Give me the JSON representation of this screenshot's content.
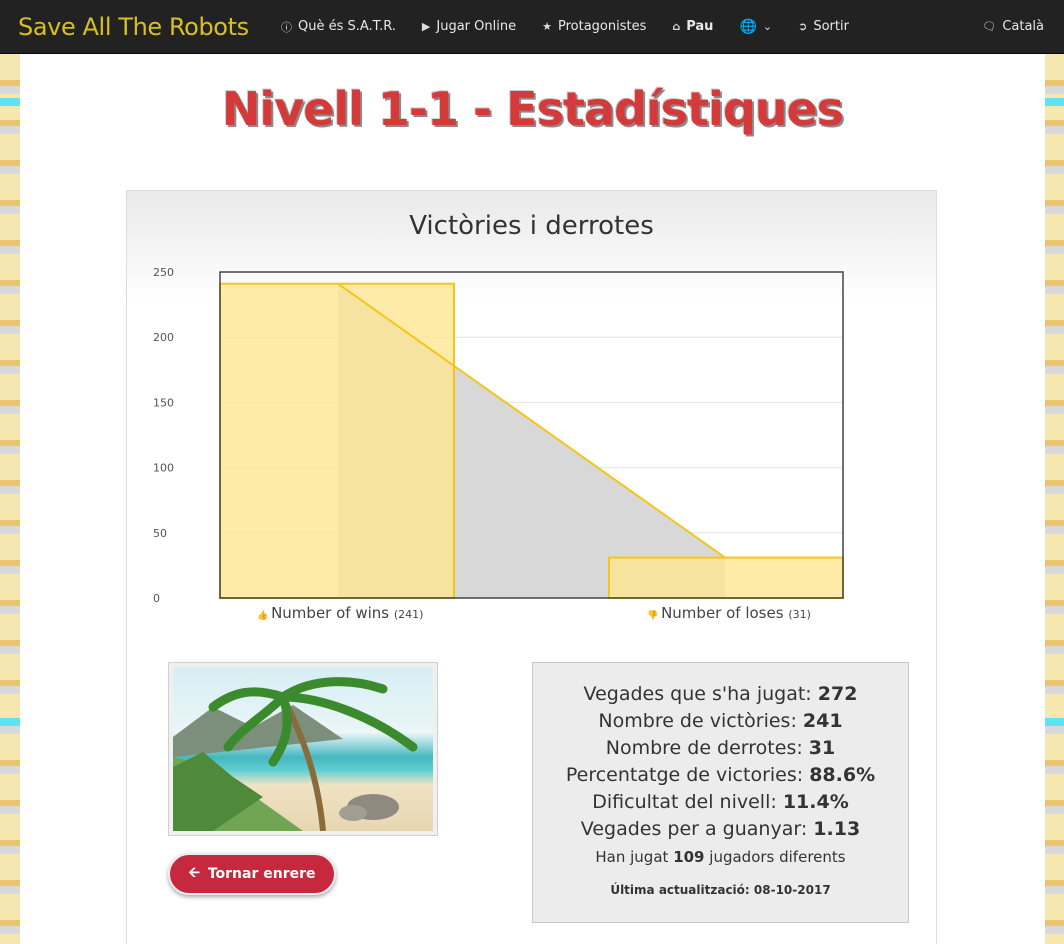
{
  "navbar": {
    "brand": "Save All The Robots",
    "items": [
      {
        "icon": "info-circle-icon",
        "label": "Què és S.A.T.R."
      },
      {
        "icon": "play-icon",
        "label": "Jugar Online"
      },
      {
        "icon": "star-icon",
        "label": "Protagonistes"
      },
      {
        "icon": "home-icon",
        "label": "Pau"
      },
      {
        "icon": "globe-icon",
        "label": ""
      },
      {
        "icon": "sign-out-icon",
        "label": "Sortir"
      }
    ],
    "language": {
      "icon": "comments-icon",
      "label": "Català"
    }
  },
  "page": {
    "title": "Nivell 1-1 - Estadístiques"
  },
  "chart_data": {
    "type": "bar",
    "title": "Victòries i derrotes",
    "categories": [
      "Number of wins",
      "Number of loses"
    ],
    "category_counts": [
      "(241)",
      "(31)"
    ],
    "values": [
      241,
      31
    ],
    "ylim": [
      0,
      250
    ],
    "yticks": [
      "0",
      "50",
      "100",
      "150",
      "200",
      "250"
    ],
    "grid": true,
    "colors": {
      "bar": "#ffe58f",
      "bar_border": "#f5c518",
      "area": "#d6d6d6"
    }
  },
  "stats": {
    "lines": [
      {
        "label": "Vegades que s'ha jugat:",
        "value": "272"
      },
      {
        "label": "Nombre de victòries:",
        "value": "241"
      },
      {
        "label": "Nombre de derrotes:",
        "value": "31"
      },
      {
        "label": "Percentatge de victories:",
        "value": "88.6%"
      },
      {
        "label": "Dificultat del nivell:",
        "value": "11.4%"
      },
      {
        "label": "Vegades per a guanyar:",
        "value": "1.13"
      }
    ],
    "players_prefix": "Han jugat",
    "players_count": "109",
    "players_suffix": "jugadors diferents",
    "updated_label": "Última actualització:",
    "updated_value": "08-10-2017"
  },
  "back_button": {
    "label": "Tornar enrere"
  }
}
